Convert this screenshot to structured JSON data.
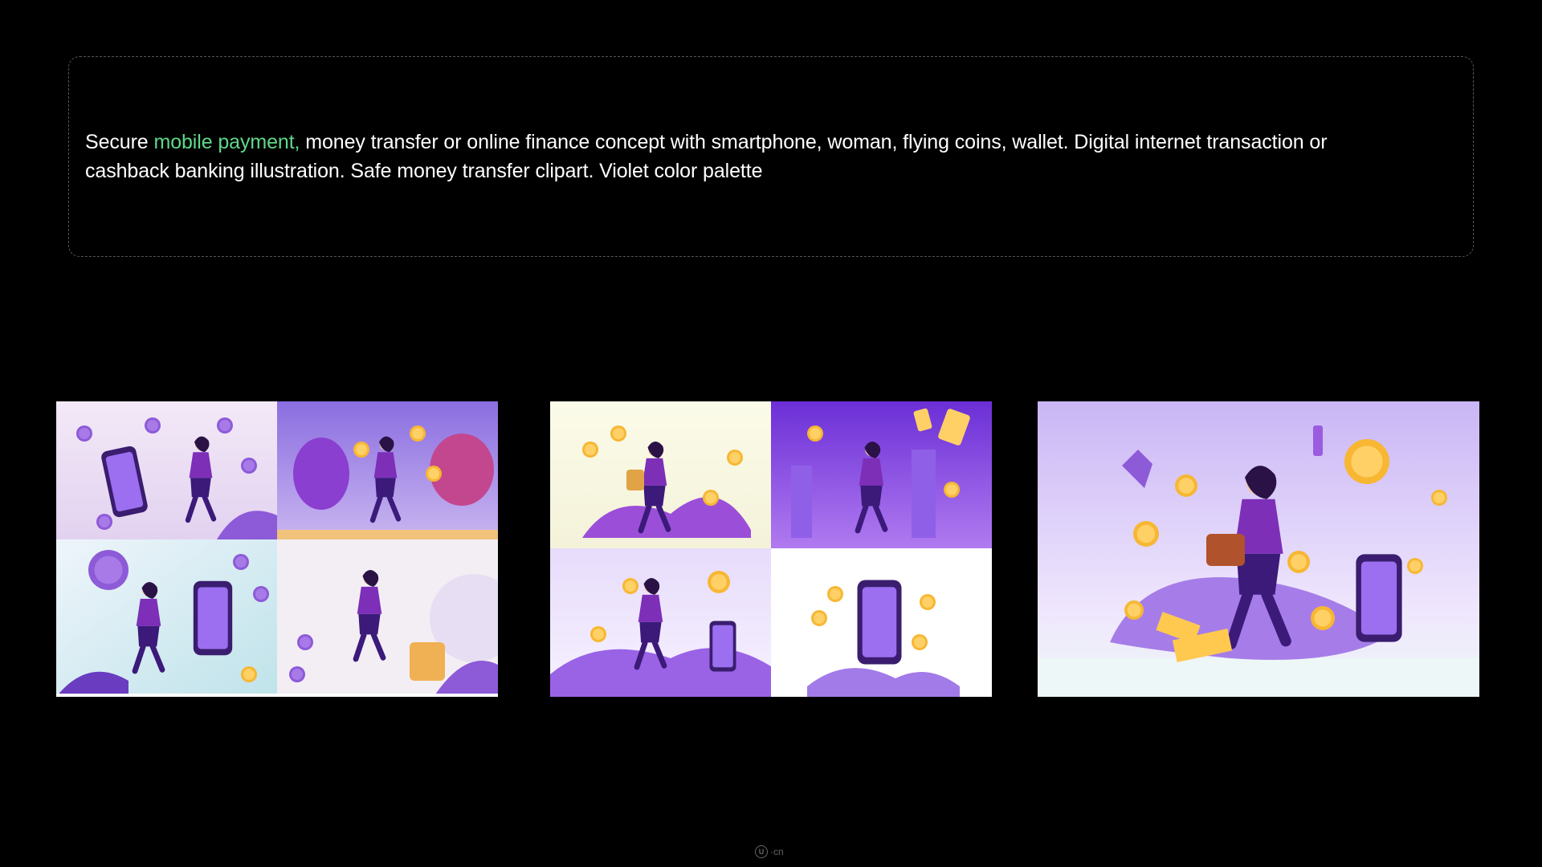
{
  "prompt": {
    "prefix": "Secure ",
    "highlight": "mobile payment,",
    "suffix": " money transfer or online finance concept with smartphone, woman, flying coins, wallet. Digital internet transaction or cashback banking illustration. Safe money transfer clipart. Violet color palette"
  },
  "results": [
    {
      "layout": "grid-2x2",
      "label": "result-set-1"
    },
    {
      "layout": "grid-2x2",
      "label": "result-set-2"
    },
    {
      "layout": "single",
      "label": "result-upscaled"
    }
  ],
  "watermark": {
    "logo": "U",
    "text": "·cn"
  },
  "colors": {
    "background": "#000000",
    "highlight": "#5fd88a",
    "violet": "#7b3fe0",
    "coin": "#f7b733"
  },
  "icons": [
    "smartphone-icon",
    "coin-icon",
    "woman-figure-icon"
  ]
}
